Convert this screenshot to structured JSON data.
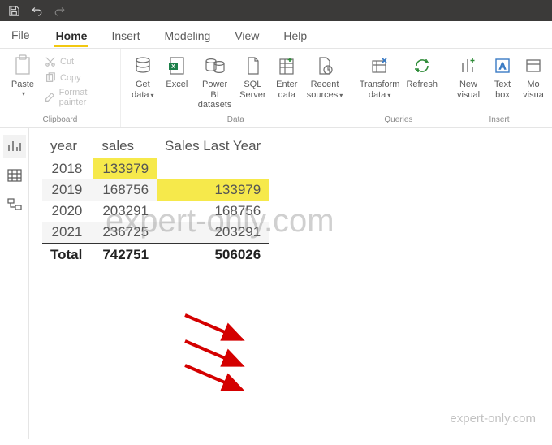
{
  "titlebar": {
    "save_icon": "save",
    "undo_icon": "undo",
    "redo_icon": "redo"
  },
  "menu": {
    "file": "File",
    "tabs": {
      "home": "Home",
      "insert": "Insert",
      "modeling": "Modeling",
      "view": "View",
      "help": "Help"
    }
  },
  "ribbon": {
    "clipboard": {
      "label": "Clipboard",
      "paste": "Paste",
      "cut": "Cut",
      "copy": "Copy",
      "fmt": "Format painter"
    },
    "data": {
      "label": "Data",
      "get": "Get\ndata",
      "excel": "Excel",
      "pbids": "Power BI\ndatasets",
      "sql": "SQL\nServer",
      "enter": "Enter\ndata",
      "recent": "Recent\nsources"
    },
    "queries": {
      "label": "Queries",
      "transform": "Transform\ndata",
      "refresh": "Refresh"
    },
    "insert": {
      "label": "Insert",
      "newvisual": "New\nvisual",
      "textbox": "Text\nbox",
      "more": "Mo\nvisua"
    }
  },
  "table": {
    "headers": {
      "year": "year",
      "sales": "sales",
      "sly": "Sales Last Year"
    },
    "rows": [
      {
        "year": "2018",
        "sales": "133979",
        "sly": ""
      },
      {
        "year": "2019",
        "sales": "168756",
        "sly": "133979"
      },
      {
        "year": "2020",
        "sales": "203291",
        "sly": "168756"
      },
      {
        "year": "2021",
        "sales": "236725",
        "sly": "203291"
      }
    ],
    "total": {
      "label": "Total",
      "sales": "742751",
      "sly": "506026"
    }
  },
  "watermark": "expert-only.com",
  "chart_data": {
    "type": "table",
    "columns": [
      "year",
      "sales",
      "Sales Last Year"
    ],
    "rows": [
      [
        "2018",
        133979,
        null
      ],
      [
        "2019",
        168756,
        133979
      ],
      [
        "2020",
        203291,
        168756
      ],
      [
        "2021",
        236725,
        203291
      ]
    ],
    "totals": {
      "sales": 742751,
      "Sales Last Year": 506026
    },
    "annotations": [
      "arrow: sales 2018 -> Sales Last Year 2019",
      "arrow: sales 2019 -> Sales Last Year 2020",
      "arrow: sales 2020 -> Sales Last Year 2021"
    ]
  }
}
